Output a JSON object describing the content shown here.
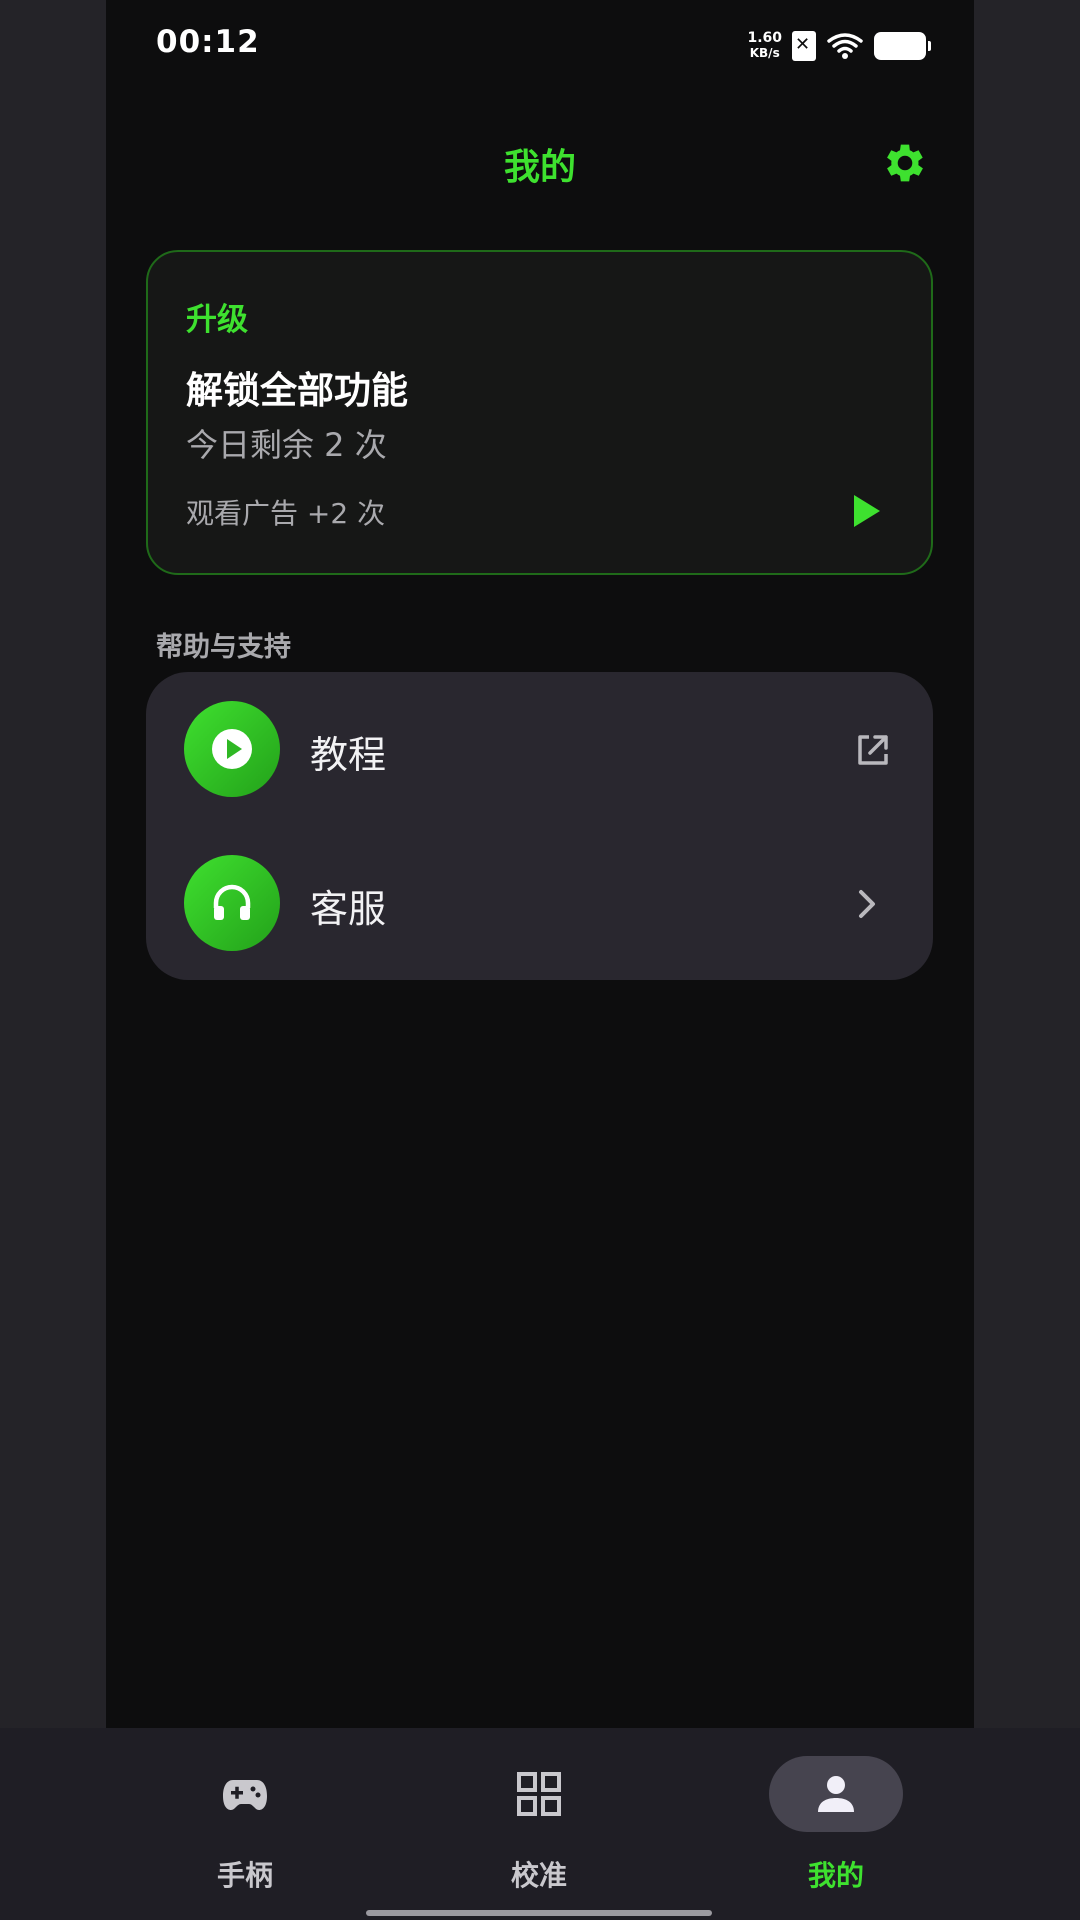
{
  "status_bar": {
    "time": "00:12",
    "net_speed_value": "1.60",
    "net_speed_unit": "KB/s"
  },
  "header": {
    "title": "我的",
    "settings_icon": "gear-icon"
  },
  "upgrade_card": {
    "label": "升级",
    "title": "解锁全部功能",
    "remaining": "今日剩余 2 次",
    "watch_ad": "观看广告 +2 次",
    "action_icon": "play-triangle-icon"
  },
  "help_section": {
    "heading": "帮助与支持",
    "items": [
      {
        "label": "教程",
        "icon": "play-circle-icon",
        "trailing_icon": "external-link-icon"
      },
      {
        "label": "客服",
        "icon": "headphones-icon",
        "trailing_icon": "chevron-right-icon"
      }
    ]
  },
  "bottom_nav": {
    "items": [
      {
        "label": "手柄",
        "icon": "gamepad-icon",
        "active": false
      },
      {
        "label": "校准",
        "icon": "grid-icon",
        "active": false
      },
      {
        "label": "我的",
        "icon": "person-icon",
        "active": true
      }
    ]
  },
  "colors": {
    "accent": "#3ee12f",
    "background": "#0d0d0e",
    "card": "#29272f",
    "nav": "#1f1e25"
  }
}
